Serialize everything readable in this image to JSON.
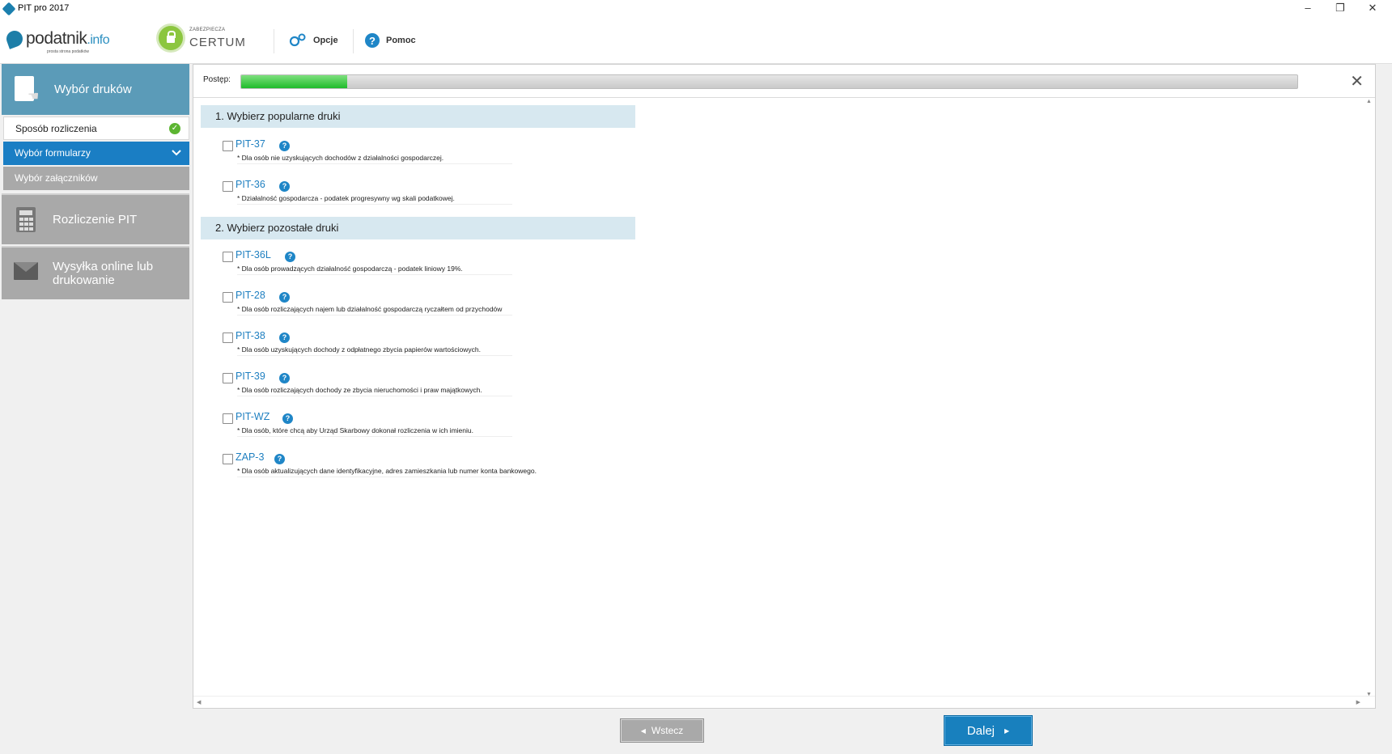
{
  "window": {
    "title": "PIT pro 2017",
    "minimize": "–",
    "restore": "❐",
    "close": "✕"
  },
  "toolbar": {
    "logo_text": "podatnik",
    "logo_suffix": ".info",
    "logo_tagline": "prosta strona podatków",
    "certum_small": "ZABEZPIECZA",
    "certum_big": "CERTUM",
    "options_label": "Opcje",
    "help_label": "Pomoc"
  },
  "sidebar": {
    "step1_label": "Wybór druków",
    "sub_items": [
      {
        "label": "Sposób rozliczenia"
      },
      {
        "label": "Wybór formularzy"
      },
      {
        "label": "Wybór załączników"
      }
    ],
    "step2_label": "Rozliczenie PIT",
    "step3_label_line1": "Wysyłka online lub",
    "step3_label_line2": "drukowanie"
  },
  "progress": {
    "label": "Postęp:",
    "value": 0.1
  },
  "sections": [
    {
      "title": "1. Wybierz popularne druki"
    },
    {
      "title": "2. Wybierz pozostałe druki"
    }
  ],
  "forms": [
    {
      "name": "PIT-37",
      "desc": "* Dla osób nie uzyskujących dochodów z działalności gospodarczej.",
      "checked": false
    },
    {
      "name": "PIT-36",
      "desc": "* Działalność gospodarcza - podatek progresywny wg skali podatkowej.",
      "checked": false
    },
    {
      "name": "PIT-36L",
      "desc": "* Dla osób prowadzących działalność gospodarczą - podatek liniowy 19%.",
      "checked": false
    },
    {
      "name": "PIT-28",
      "desc": "* Dla osób rozliczających najem lub działalność gospodarczą ryczałtem od przychodów",
      "checked": false
    },
    {
      "name": "PIT-38",
      "desc": "* Dla osób uzyskujących dochody z odpłatnego zbycia papierów wartościowych.",
      "checked": false
    },
    {
      "name": "PIT-39",
      "desc": "* Dla osób rozliczających dochody ze zbycia nieruchomości i praw majątkowych.",
      "checked": false
    },
    {
      "name": "PIT-WZ",
      "desc": "* Dla osób, które chcą aby Urząd Skarbowy dokonał rozliczenia w ich imieniu.",
      "checked": false
    },
    {
      "name": "ZAP-3",
      "desc": "* Dla osób aktualizujących dane identyfikacyjne, adres zamieszkania lub numer konta bankowego.",
      "checked": false
    }
  ],
  "help_glyph": "?",
  "buttons": {
    "back_label": "Wstecz",
    "next_label": "Dalej"
  },
  "colors": {
    "accent": "#1a7ec4",
    "active_step": "#5b9bb8",
    "progress": "#22bb2e",
    "link": "#1e7fc0"
  }
}
